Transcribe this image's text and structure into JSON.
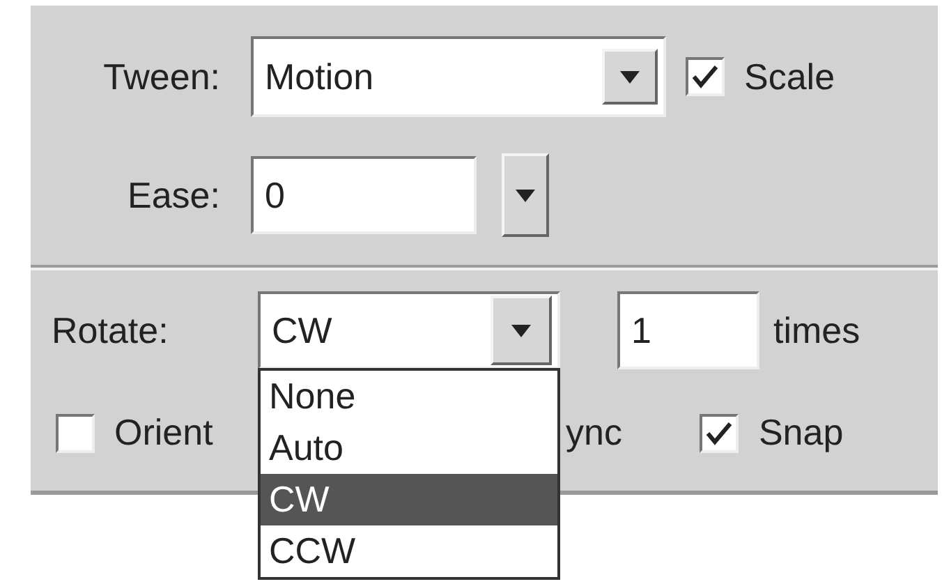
{
  "tween": {
    "label": "Tween:",
    "value": "Motion",
    "scale": {
      "label": "Scale",
      "checked": true
    }
  },
  "ease": {
    "label": "Ease:",
    "value": "0"
  },
  "rotate": {
    "label": "Rotate:",
    "value": "CW",
    "count": "1",
    "count_label": "times",
    "options": [
      {
        "label": "None",
        "selected": false
      },
      {
        "label": "Auto",
        "selected": false
      },
      {
        "label": "CW",
        "selected": true
      },
      {
        "label": "CCW",
        "selected": false
      }
    ]
  },
  "orient": {
    "label": "Orient",
    "checked": false
  },
  "sync": {
    "label": "ync"
  },
  "snap": {
    "label": "Snap",
    "checked": true
  }
}
